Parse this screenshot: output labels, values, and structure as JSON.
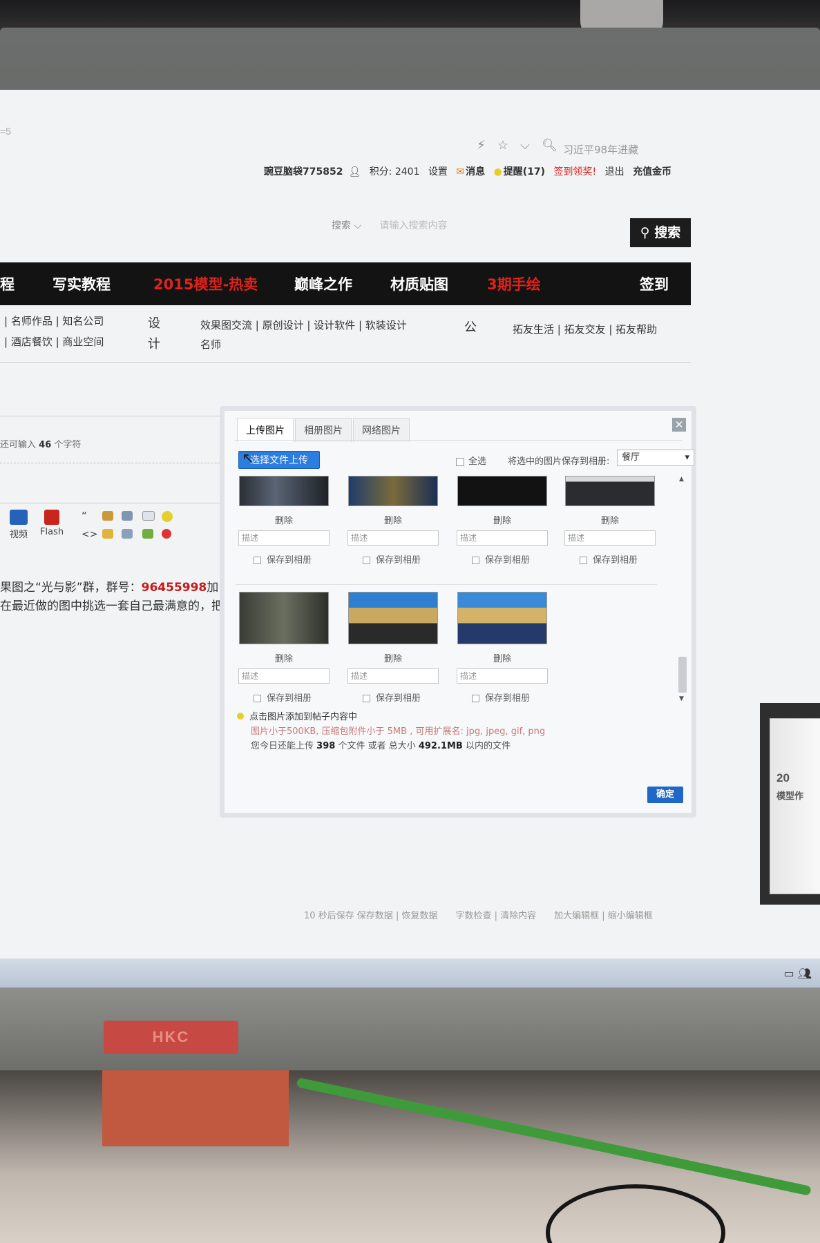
{
  "browser": {
    "url_stub": "=5",
    "address_search_hint": "习近平98年进藏"
  },
  "userbar": {
    "username": "豌豆脑袋775852",
    "points": "积分: 2401",
    "settings": "设置",
    "messages": "消息",
    "reminders": "提醒(17)",
    "checkin_reward": "签到领奖!",
    "logout": "退出",
    "recharge": "充值金币"
  },
  "search": {
    "label": "搜索",
    "placeholder": "请输入搜索内容",
    "button": "搜索"
  },
  "nav": {
    "items": [
      "程",
      "写实教程",
      "2015模型-热卖",
      "巅峰之作",
      "材质贴图",
      "3期手绘",
      "签到"
    ]
  },
  "subnav": {
    "left1": "| 名师作品 | 知名公司",
    "left2": "| 酒店餐饮 | 商业空间",
    "she": "设",
    "ji": "计",
    "mid1": "效果图交流 | 原创设计 | 设计软件 | 软装设计",
    "mid2": "名师",
    "gong": "公",
    "right1": "拓友生活 | 拓友交友 | 拓友帮助"
  },
  "editor": {
    "char_count_prefix": "还可输入",
    "char_count": "46",
    "char_count_suffix": "个字符",
    "video_label": "视频",
    "flash_label": "Flash"
  },
  "post": {
    "line1_prefix": "果图之“光与影”群，群号：",
    "group_number": "96455998",
    "line1_suffix": "加",
    "line2": "在最近做的图中挑选一套自己最满意的，把"
  },
  "footer": {
    "links": "10 秒后保存 保存数据 | 恢复数据　　字数检查 | 清除内容　　加大编辑框 | 缩小编辑框"
  },
  "book": {
    "text1": "20",
    "text2": "模型作"
  },
  "dialog": {
    "tabs": [
      "上传图片",
      "相册图片",
      "网络图片"
    ],
    "upload_button": "选择文件上传",
    "select_all": "全选",
    "save_to_album_label": "将选中的图片保存到相册:",
    "album_selected": "餐厅",
    "delete_label": "删除",
    "desc_placeholder": "描述",
    "save_album_label": "保存到相册",
    "tip_click": "点击图片添加到帖子内容中",
    "tip_limits": "图片小于500KB, 压缩包附件小于 5MB , 可用扩展名: jpg, jpeg, gif, png",
    "tip_quota_prefix": "您今日还能上传",
    "tip_quota_files": "398",
    "tip_quota_mid": "个文件 或者 总大小",
    "tip_quota_size": "492.1MB",
    "tip_quota_suffix": "以内的文件",
    "ok_button": "确定"
  },
  "monitor": {
    "brand": "HKC"
  },
  "colors": {
    "nav_bg": "#131313",
    "nav_red": "#e0221c",
    "upload_blue": "#2b7de0",
    "ok_blue": "#1f67c8"
  }
}
